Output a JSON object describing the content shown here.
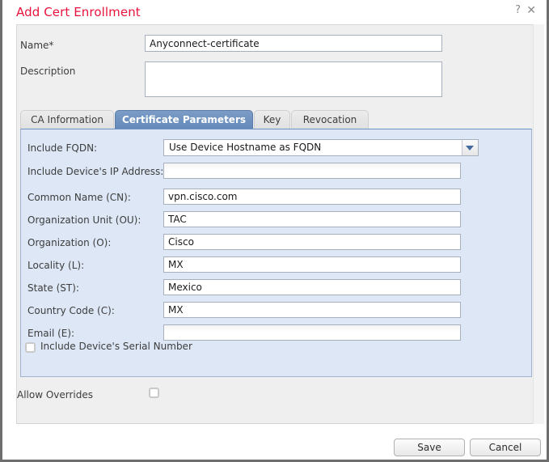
{
  "window": {
    "title": "Add Cert Enrollment",
    "help_icon": "question-mark-icon",
    "close_icon": "close-icon"
  },
  "header": {
    "name_label": "Name*",
    "name_value": "Anyconnect-certificate",
    "description_label": "Description",
    "description_value": ""
  },
  "tabs": [
    {
      "label": "CA Information",
      "active": false
    },
    {
      "label": "Certificate Parameters",
      "active": true
    },
    {
      "label": "Key",
      "active": false
    },
    {
      "label": "Revocation",
      "active": false
    }
  ],
  "certificate_parameters": {
    "fqdn": {
      "label": "Include FQDN:",
      "value": "Use Device Hostname as FQDN",
      "type": "dropdown"
    },
    "fields": [
      {
        "label": "Include Device's IP Address:",
        "value": ""
      },
      {
        "label": "Common Name (CN):",
        "value": "vpn.cisco.com"
      },
      {
        "label": "Organization Unit (OU):",
        "value": "TAC"
      },
      {
        "label": "Organization (O):",
        "value": "Cisco"
      },
      {
        "label": "Locality (L):",
        "value": "MX"
      },
      {
        "label": "State (ST):",
        "value": "Mexico"
      },
      {
        "label": "Country Code (C):",
        "value": "MX"
      },
      {
        "label": "Email (E):",
        "value": ""
      }
    ],
    "serial_checkbox": {
      "label": "Include Device's Serial Number",
      "checked": false
    }
  },
  "allow_overrides": {
    "label": "Allow Overrides",
    "checked": false
  },
  "footer": {
    "save_label": "Save",
    "cancel_label": "Cancel"
  },
  "colors": {
    "title_red": "#e8123c",
    "active_tab_blue": "#6d92c0",
    "panel_blue": "#dde7f5",
    "body_grey": "#efefef"
  }
}
